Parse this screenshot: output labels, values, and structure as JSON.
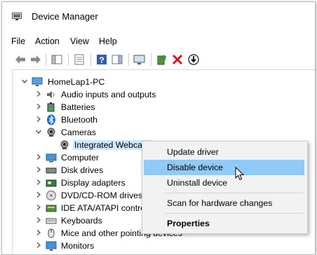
{
  "window": {
    "title": "Device Manager"
  },
  "menu": [
    "File",
    "Action",
    "View",
    "Help"
  ],
  "tree": {
    "root": "HomeLap1-PC",
    "items": [
      {
        "label": "Audio inputs and outputs",
        "icon": "speaker-icon",
        "expanded": false
      },
      {
        "label": "Batteries",
        "icon": "battery-icon",
        "expanded": false
      },
      {
        "label": "Bluetooth",
        "icon": "bluetooth-icon",
        "expanded": false
      },
      {
        "label": "Cameras",
        "icon": "camera-icon",
        "expanded": true,
        "children": [
          {
            "label": "Integrated Webcam",
            "icon": "webcam-icon",
            "selected": true
          }
        ]
      },
      {
        "label": "Computer",
        "icon": "computer-icon",
        "expanded": false
      },
      {
        "label": "Disk drives",
        "icon": "disk-drive-icon",
        "expanded": false
      },
      {
        "label": "Display adapters",
        "icon": "display-adapter-icon",
        "expanded": false
      },
      {
        "label": "DVD/CD-ROM drives",
        "icon": "dvd-drive-icon",
        "expanded": false
      },
      {
        "label": "IDE ATA/ATAPI controllers",
        "icon": "ide-controller-icon",
        "expanded": false
      },
      {
        "label": "Keyboards",
        "icon": "keyboard-icon",
        "expanded": false
      },
      {
        "label": "Mice and other pointing devices",
        "icon": "mouse-icon",
        "expanded": false
      },
      {
        "label": "Monitors",
        "icon": "monitor-icon",
        "expanded": false
      }
    ]
  },
  "context_menu": {
    "items": [
      {
        "label": "Update driver",
        "highlighted": false,
        "bold": false
      },
      {
        "label": "Disable device",
        "highlighted": true,
        "bold": false
      },
      {
        "label": "Uninstall device",
        "highlighted": false,
        "bold": false
      },
      {
        "label": "Scan for hardware changes",
        "highlighted": false,
        "bold": false
      },
      {
        "label": "Properties",
        "highlighted": false,
        "bold": true
      }
    ]
  },
  "colors": {
    "highlight": "#91c9f7",
    "selection": "#cde8ff",
    "uninstall_red": "#d01c1c",
    "help_blue": "#2f5fb0"
  }
}
